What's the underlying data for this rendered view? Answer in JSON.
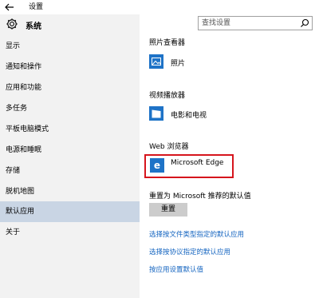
{
  "titlebar": {
    "title": "设置"
  },
  "sidebar": {
    "title": "系统",
    "items": [
      {
        "label": "显示"
      },
      {
        "label": "通知和操作"
      },
      {
        "label": "应用和功能"
      },
      {
        "label": "多任务"
      },
      {
        "label": "平板电脑模式"
      },
      {
        "label": "电源和睡眠"
      },
      {
        "label": "存储"
      },
      {
        "label": "脱机地图"
      },
      {
        "label": "默认应用"
      },
      {
        "label": "关于"
      }
    ],
    "active_item": "默认应用"
  },
  "search": {
    "placeholder": "查找设置"
  },
  "content": {
    "photo_viewer": {
      "heading": "照片查看器",
      "app": "照片"
    },
    "video_player": {
      "heading": "视频播放器",
      "app": "电影和电视"
    },
    "web_browser": {
      "heading": "Web 浏览器",
      "app": "Microsoft Edge"
    },
    "reset": {
      "heading": "重置为 Microsoft 推荐的默认值",
      "button": "重置"
    },
    "links": [
      "选择按文件类型指定的默认应用",
      "选择按协议指定的默认应用",
      "按应用设置默认值"
    ]
  },
  "colors": {
    "accent": "#1e73c7",
    "active_nav": "#c9d5e4",
    "highlight_frame": "#d6151d",
    "link": "#1565c0"
  }
}
